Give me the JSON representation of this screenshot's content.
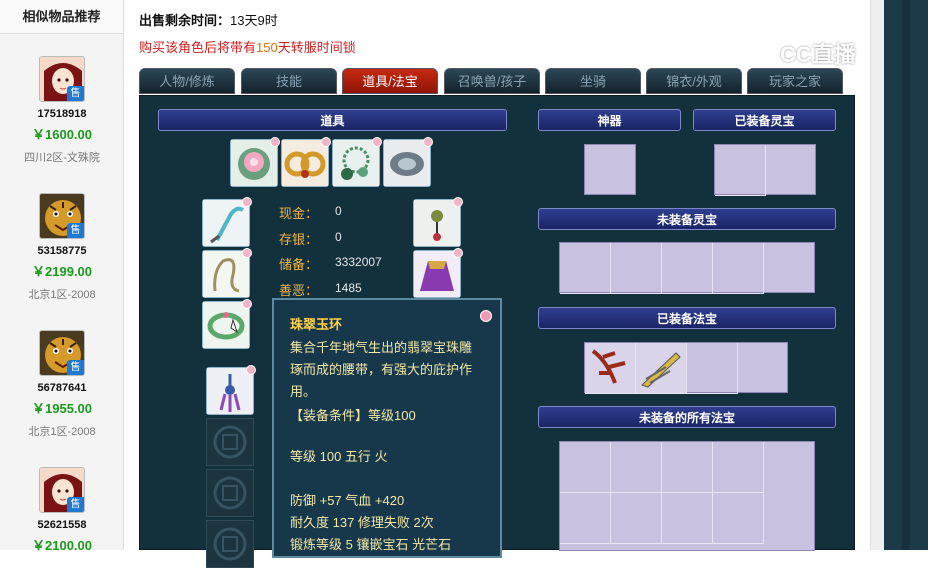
{
  "sidebar": {
    "title": "相似物品推荐",
    "sale_badge": "售",
    "items": [
      {
        "id": "17518918",
        "price": "￥1600.00",
        "server": "四川2区-文殊院",
        "avatar": "girl"
      },
      {
        "id": "53158775",
        "price": "￥2199.00",
        "server": "北京1区-2008",
        "avatar": "tiger"
      },
      {
        "id": "56787641",
        "price": "￥1955.00",
        "server": "北京1区-2008",
        "avatar": "tiger"
      },
      {
        "id": "52621558",
        "price": "￥2100.00",
        "server": "",
        "avatar": "girl"
      }
    ]
  },
  "header": {
    "timer_label": "出售剩余时间：",
    "timer_value": "13天9时",
    "notice_prefix": "购买该角色后将带有",
    "notice_num": "150",
    "notice_suffix": "天转服时间锁",
    "watermark": "CC直播"
  },
  "tabs": [
    "人物/修炼",
    "技能",
    "道具/法宝",
    "召唤兽/孩子",
    "坐骑",
    "锦衣/外观",
    "玩家之家"
  ],
  "active_tab": "道具/法宝",
  "props": {
    "header": "道具",
    "stats": [
      {
        "label": "现金：",
        "value": "0"
      },
      {
        "label": "存银：",
        "value": "0"
      },
      {
        "label": "储备：",
        "value": "3332007"
      },
      {
        "label": "善恶：",
        "value": "1485"
      }
    ]
  },
  "sections": {
    "artifact": "神器",
    "equipped_lingbao": "已装备灵宝",
    "unequipped_lingbao": "未装备灵宝",
    "equipped_fabao": "已装备法宝",
    "all_unequipped_fabao": "未装备的所有法宝"
  },
  "tooltip": {
    "name": "珠翠玉环",
    "desc": "集合千年地气生出的翡翠宝珠雕琢而成的腰带，有强大的庇护作用。",
    "req": "【装备条件】等级100",
    "line1": "等级 100 五行 火",
    "line2": "防御 +57 气血 +420",
    "line3": "耐久度 137 修理失败 2次",
    "line4": "锻炼等级 5 镶嵌宝石 光芒石"
  },
  "colors": {
    "accent_red": "#c72a10",
    "panel_bg": "#13303d",
    "price_green": "#1a9a1a"
  }
}
